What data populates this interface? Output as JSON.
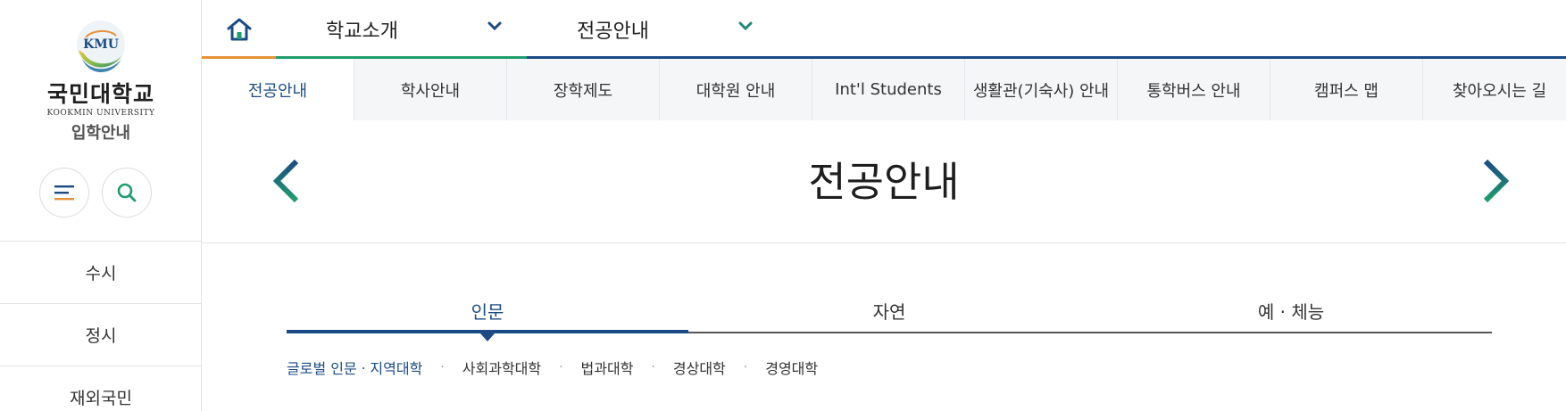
{
  "sidebar": {
    "logo": {
      "emblem_text": "KMU",
      "name_ko": "국민대학교",
      "name_en": "KOOKMIN UNIVERSITY",
      "subtitle": "입학안내"
    },
    "buttons": [
      {
        "icon": "menu-icon"
      },
      {
        "icon": "search-icon"
      }
    ],
    "menu": [
      {
        "label": "수시"
      },
      {
        "label": "정시"
      },
      {
        "label": "재외국민"
      }
    ]
  },
  "topnav": {
    "home_icon": "home-icon",
    "dropdowns": [
      {
        "label": "학교소개"
      },
      {
        "label": "전공안내"
      }
    ]
  },
  "subtabs": [
    {
      "label": "전공안내",
      "active": true
    },
    {
      "label": "학사안내"
    },
    {
      "label": "장학제도"
    },
    {
      "label": "대학원 안내"
    },
    {
      "label": "Int'l Students"
    },
    {
      "label": "생활관(기숙사) 안내"
    },
    {
      "label": "통학버스 안내"
    },
    {
      "label": "캠퍼스 맵"
    },
    {
      "label": "찾아오시는 길"
    }
  ],
  "page": {
    "title": "전공안내"
  },
  "category_tabs": [
    {
      "label": "인문",
      "active": true
    },
    {
      "label": "자연"
    },
    {
      "label": "예 · 체능"
    }
  ],
  "colleges": [
    {
      "label": "글로벌 인문ㆍ지역대학",
      "active": true
    },
    {
      "label": "사회과학대학"
    },
    {
      "label": "법과대학"
    },
    {
      "label": "경상대학"
    },
    {
      "label": "경영대학"
    }
  ],
  "colors": {
    "primary_blue": "#1a4b85",
    "accent_orange": "#e8913a",
    "accent_green": "#1f9e6c",
    "arrow_teal": "#1f8a7a"
  },
  "separator": "·"
}
